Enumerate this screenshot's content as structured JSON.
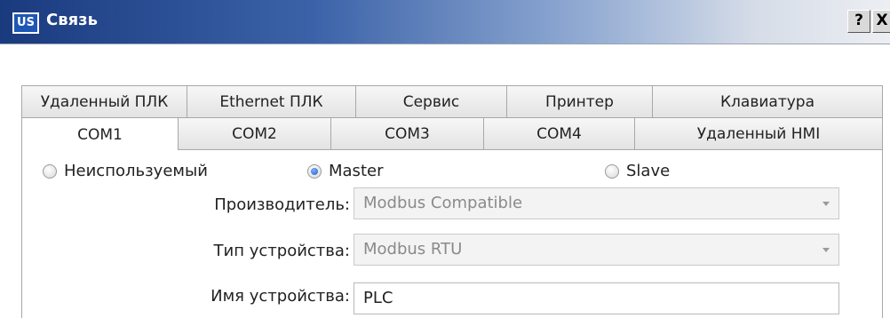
{
  "window": {
    "title": "Связь",
    "app_icon_text": "US",
    "help_label": "?",
    "close_label": "X"
  },
  "tabs": {
    "back_row": [
      "Удаленный ПЛК",
      "Ethernet ПЛК",
      "Сервис",
      "Принтер",
      "Клавиатура"
    ],
    "front_row": [
      "COM1",
      "COM2",
      "COM3",
      "COM4",
      "Удаленный HMI"
    ],
    "active": "COM1"
  },
  "mode": {
    "options": [
      "Неиспользуемый",
      "Master",
      "Slave"
    ],
    "selected": "Master"
  },
  "form": {
    "manufacturer_label": "Производитель:",
    "manufacturer_value": "Modbus Compatible",
    "device_type_label": "Тип устройства:",
    "device_type_value": "Modbus RTU",
    "device_name_label": "Имя устройства:",
    "device_name_value": "PLC"
  }
}
